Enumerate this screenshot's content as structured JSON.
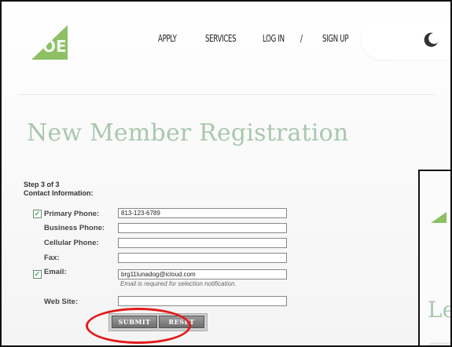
{
  "nav": {
    "apply": "APPLY",
    "services": "SERVICES",
    "login": "LOG IN",
    "separator": "/",
    "signup": "SIGN UP"
  },
  "page": {
    "title": "New Member Registration"
  },
  "form": {
    "step": "Step 3 of 3",
    "section": "Contact Information:",
    "fields": [
      {
        "label": "Primary Phone:",
        "value": "813-123-6789",
        "checked": true
      },
      {
        "label": "Business Phone:",
        "value": "",
        "checked": false
      },
      {
        "label": "Cellular Phone:",
        "value": "",
        "checked": false
      },
      {
        "label": "Fax:",
        "value": "",
        "checked": false
      },
      {
        "label": "Email:",
        "value": "brg11lunadog@icloud.com",
        "checked": true
      },
      {
        "label": "Web Site:",
        "value": "",
        "checked": false
      }
    ],
    "email_hint": "Email is required for selection notification.",
    "submit_label": "SUBMIT",
    "reset_label": "RESET"
  },
  "overlay": {
    "title_fragment": "Le"
  },
  "colors": {
    "accent_green": "#a9c7ae",
    "highlight_red": "#e31b1b"
  },
  "icons": {
    "logo": "brand-logo-icon",
    "theme": "moon-icon"
  }
}
